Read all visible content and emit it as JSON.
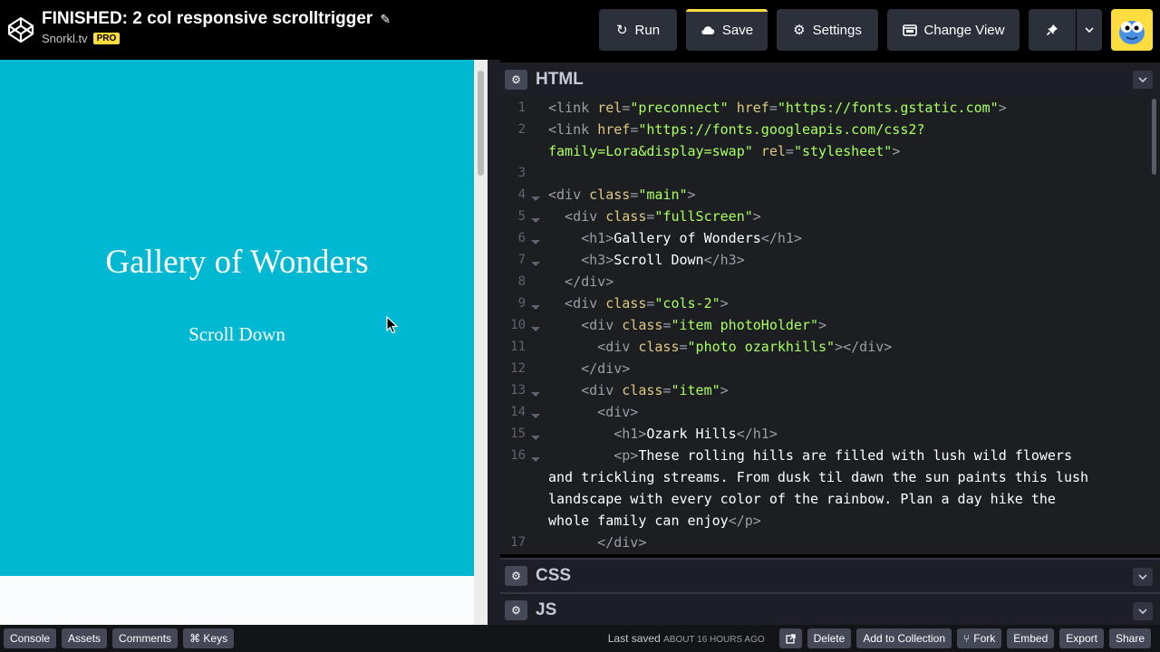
{
  "header": {
    "title": "FINISHED: 2 col responsive scrolltrigger",
    "owner": "Snorkl.tv",
    "pro_badge": "PRO",
    "buttons": {
      "run": "Run",
      "save": "Save",
      "settings": "Settings",
      "change_view": "Change View"
    }
  },
  "preview": {
    "heading": "Gallery of Wonders",
    "subheading": "Scroll Down",
    "accent_color": "#00b8d1"
  },
  "panels": {
    "html": "HTML",
    "css": "CSS",
    "js": "JS"
  },
  "code_lines": [
    {
      "num": "1",
      "fold": false,
      "parts": [
        [
          "tg",
          "<link "
        ],
        [
          "at",
          "rel"
        ],
        [
          "eq",
          "="
        ],
        [
          "st",
          "\"preconnect\""
        ],
        [
          "tg",
          " "
        ],
        [
          "at",
          "href"
        ],
        [
          "eq",
          "="
        ],
        [
          "st",
          "\"https://fonts.gstatic.com\""
        ],
        [
          "tg",
          ">"
        ]
      ]
    },
    {
      "num": "2",
      "fold": false,
      "parts": [
        [
          "tg",
          "<link "
        ],
        [
          "at",
          "href"
        ],
        [
          "eq",
          "="
        ],
        [
          "st",
          "\"https://fonts.googleapis.com/css2?"
        ]
      ]
    },
    {
      "num": "",
      "fold": false,
      "parts": [
        [
          "st",
          "family=Lora&display=swap\""
        ],
        [
          "tg",
          " "
        ],
        [
          "at",
          "rel"
        ],
        [
          "eq",
          "="
        ],
        [
          "st",
          "\"stylesheet\""
        ],
        [
          "tg",
          ">"
        ]
      ]
    },
    {
      "num": "3",
      "fold": false,
      "parts": []
    },
    {
      "num": "4",
      "fold": true,
      "parts": [
        [
          "tg",
          "<div "
        ],
        [
          "at",
          "class"
        ],
        [
          "eq",
          "="
        ],
        [
          "st",
          "\"main\""
        ],
        [
          "tg",
          ">"
        ]
      ]
    },
    {
      "num": "5",
      "fold": true,
      "parts": [
        [
          "tg",
          "  <div "
        ],
        [
          "at",
          "class"
        ],
        [
          "eq",
          "="
        ],
        [
          "st",
          "\"fullScreen\""
        ],
        [
          "tg",
          ">"
        ]
      ]
    },
    {
      "num": "6",
      "fold": true,
      "parts": [
        [
          "tg",
          "    <h1>"
        ],
        [
          "tx",
          "Gallery of Wonders"
        ],
        [
          "tg",
          "</h1>"
        ]
      ]
    },
    {
      "num": "7",
      "fold": true,
      "parts": [
        [
          "tg",
          "    <h3>"
        ],
        [
          "tx",
          "Scroll Down"
        ],
        [
          "tg",
          "</h3>"
        ]
      ]
    },
    {
      "num": "8",
      "fold": false,
      "parts": [
        [
          "tg",
          "  </div>"
        ]
      ]
    },
    {
      "num": "9",
      "fold": true,
      "parts": [
        [
          "tg",
          "  <div "
        ],
        [
          "at",
          "class"
        ],
        [
          "eq",
          "="
        ],
        [
          "st",
          "\"cols-2\""
        ],
        [
          "tg",
          ">"
        ]
      ]
    },
    {
      "num": "10",
      "fold": true,
      "parts": [
        [
          "tg",
          "    <div "
        ],
        [
          "at",
          "class"
        ],
        [
          "eq",
          "="
        ],
        [
          "st",
          "\"item photoHolder\""
        ],
        [
          "tg",
          ">"
        ]
      ]
    },
    {
      "num": "11",
      "fold": false,
      "parts": [
        [
          "tg",
          "      <div "
        ],
        [
          "at",
          "class"
        ],
        [
          "eq",
          "="
        ],
        [
          "st",
          "\"photo ozarkhills\""
        ],
        [
          "tg",
          "></div>"
        ]
      ]
    },
    {
      "num": "12",
      "fold": false,
      "parts": [
        [
          "tg",
          "    </div>"
        ]
      ]
    },
    {
      "num": "13",
      "fold": true,
      "parts": [
        [
          "tg",
          "    <div "
        ],
        [
          "at",
          "class"
        ],
        [
          "eq",
          "="
        ],
        [
          "st",
          "\"item\""
        ],
        [
          "tg",
          ">"
        ]
      ]
    },
    {
      "num": "14",
      "fold": true,
      "parts": [
        [
          "tg",
          "      <div>"
        ]
      ]
    },
    {
      "num": "15",
      "fold": true,
      "parts": [
        [
          "tg",
          "        <h1>"
        ],
        [
          "tx",
          "Ozark Hills"
        ],
        [
          "tg",
          "</h1>"
        ]
      ]
    },
    {
      "num": "16",
      "fold": true,
      "parts": [
        [
          "tg",
          "        <p>"
        ],
        [
          "tx",
          "These rolling hills are filled with lush wild flowers"
        ]
      ]
    },
    {
      "num": "",
      "fold": false,
      "parts": [
        [
          "tx",
          "and trickling streams. From dusk til dawn the sun paints this lush"
        ]
      ]
    },
    {
      "num": "",
      "fold": false,
      "parts": [
        [
          "tx",
          "landscape with every color of the rainbow. Plan a day hike the"
        ]
      ]
    },
    {
      "num": "",
      "fold": false,
      "parts": [
        [
          "tx",
          "whole family can enjoy"
        ],
        [
          "tg",
          "</p>"
        ]
      ]
    },
    {
      "num": "17",
      "fold": false,
      "parts": [
        [
          "tg",
          "      </div>"
        ]
      ]
    }
  ],
  "footer": {
    "left": [
      "Console",
      "Assets",
      "Comments",
      "⌘ Keys"
    ],
    "saved_label": "Last saved",
    "saved_time": "ABOUT 16 HOURS AGO",
    "right": [
      "Delete",
      "Add to Collection",
      "Fork",
      "Embed",
      "Export",
      "Share"
    ]
  }
}
